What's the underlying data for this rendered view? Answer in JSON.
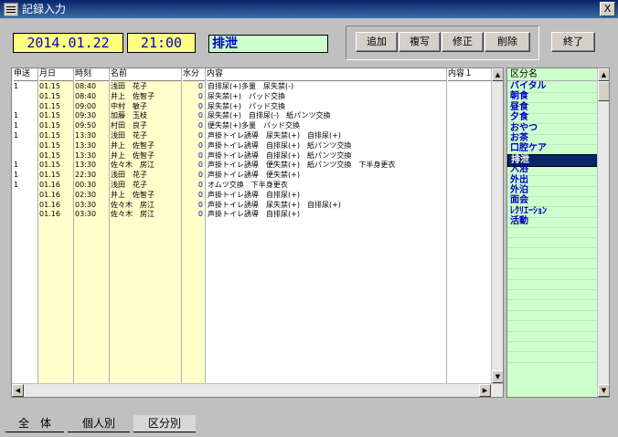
{
  "window": {
    "title": "記録入力",
    "close_label": "X"
  },
  "header": {
    "date": "2014.01.22",
    "time": "21:00",
    "category": "排泄"
  },
  "toolbar": {
    "add": "追加",
    "copy": "複写",
    "edit": "修正",
    "delete": "削除",
    "exit": "終了"
  },
  "grid": {
    "columns": [
      "申送",
      "月日",
      "時刻",
      "名前",
      "水分",
      "内容",
      "内容１"
    ],
    "rows": [
      {
        "flag": "1",
        "date": "01.15",
        "time": "08:40",
        "name": "浅田　花子",
        "water": "0",
        "content": "自排尿(+)多量　尿失禁(-)"
      },
      {
        "flag": "",
        "date": "01.15",
        "time": "08:40",
        "name": "井上　佐智子",
        "water": "0",
        "content": "尿失禁(+)　パッド交換"
      },
      {
        "flag": "",
        "date": "01.15",
        "time": "09:00",
        "name": "中村　敏子",
        "water": "0",
        "content": "尿失禁(+)　パッド交換"
      },
      {
        "flag": "1",
        "date": "01.15",
        "time": "09:30",
        "name": "加藤　玉枝",
        "water": "0",
        "content": "尿失禁(+)　自排尿(-)　紙パンツ交換"
      },
      {
        "flag": "1",
        "date": "01.15",
        "time": "09:50",
        "name": "村田　良子",
        "water": "0",
        "content": "便失禁(+)多量　パッド交換"
      },
      {
        "flag": "1",
        "date": "01.15",
        "time": "13:30",
        "name": "浅田　花子",
        "water": "0",
        "content": "声掛トイレ誘導　尿失禁(+)　自排尿(+)"
      },
      {
        "flag": "",
        "date": "01.15",
        "time": "13:30",
        "name": "井上　佐智子",
        "water": "0",
        "content": "声掛トイレ誘導　自排尿(+)　紙パンツ交換"
      },
      {
        "flag": "",
        "date": "01.15",
        "time": "13:30",
        "name": "井上　佐智子",
        "water": "0",
        "content": "声掛トイレ誘導　自排尿(+)　紙パンツ交換"
      },
      {
        "flag": "1",
        "date": "01.15",
        "time": "13:30",
        "name": "佐々木　房江",
        "water": "0",
        "content": "声掛トイレ誘導　便失禁(+)　紙パンツ交換　下半身更衣"
      },
      {
        "flag": "1",
        "date": "01.15",
        "time": "22:30",
        "name": "浅田　花子",
        "water": "0",
        "content": "声掛トイレ誘導　便失禁(+)"
      },
      {
        "flag": "1",
        "date": "01.16",
        "time": "00:30",
        "name": "浅田　花子",
        "water": "0",
        "content": "オムツ交換　下半身更衣"
      },
      {
        "flag": "",
        "date": "01.16",
        "time": "02:30",
        "name": "井上　佐智子",
        "water": "0",
        "content": "声掛トイレ誘導　自排尿(+)"
      },
      {
        "flag": "",
        "date": "01.16",
        "time": "03:30",
        "name": "佐々木　房江",
        "water": "0",
        "content": "声掛トイレ誘導　尿失禁(+)　自排尿(+)"
      },
      {
        "flag": "",
        "date": "01.16",
        "time": "03:30",
        "name": "佐々木　房江",
        "water": "0",
        "content": "声掛トイレ誘導　自排尿(+)"
      }
    ]
  },
  "category_list": {
    "header": "区分名",
    "items": [
      "バイタル",
      "朝食",
      "昼食",
      "夕食",
      "おやつ",
      "お茶",
      "口腔ケア",
      "排泄",
      "入浴",
      "外出",
      "外泊",
      "面会",
      "ﾚｸﾘｴｰｼｮﾝ",
      "活動"
    ],
    "selected": "排泄"
  },
  "tabs": [
    "全　体",
    "個人別",
    "区分別"
  ],
  "colors": {
    "yellow": "#ffff80",
    "green": "#ccffcc",
    "blue": "#0000c0",
    "title": "#0a246a"
  }
}
